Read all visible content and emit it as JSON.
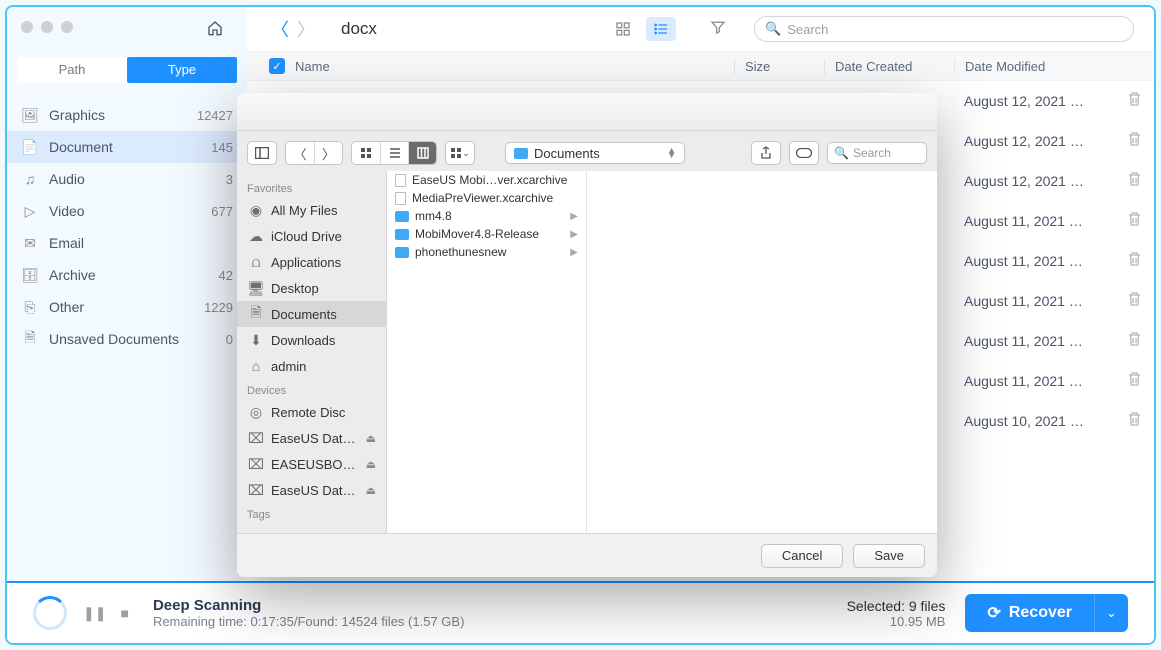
{
  "tabs": {
    "path": "Path",
    "type": "Type"
  },
  "categories": [
    {
      "icon": "image",
      "label": "Graphics",
      "count": "12427"
    },
    {
      "icon": "doc",
      "label": "Document",
      "count": "145",
      "active": true
    },
    {
      "icon": "audio",
      "label": "Audio",
      "count": "3"
    },
    {
      "icon": "video",
      "label": "Video",
      "count": "677"
    },
    {
      "icon": "email",
      "label": "Email",
      "count": ""
    },
    {
      "icon": "archive",
      "label": "Archive",
      "count": "42"
    },
    {
      "icon": "other",
      "label": "Other",
      "count": "1229"
    },
    {
      "icon": "unsaved",
      "label": "Unsaved Documents",
      "count": "0"
    }
  ],
  "breadcrumb": "docx",
  "search_placeholder": "Search",
  "cols": {
    "name": "Name",
    "size": "Size",
    "dc": "Date Created",
    "dm": "Date Modified"
  },
  "rows": [
    {
      "dm": "August 12, 2021 …"
    },
    {
      "dm": "August 12, 2021 …"
    },
    {
      "dm": "August 12, 2021 …"
    },
    {
      "dm": "August 11, 2021 …"
    },
    {
      "dm": "August 11, 2021 …"
    },
    {
      "dm": "August 11, 2021 …"
    },
    {
      "dm": "August 11, 2021 …"
    },
    {
      "dm": "August 11, 2021 …"
    },
    {
      "dm": "August 10, 2021 …"
    }
  ],
  "scan": {
    "title": "Deep Scanning",
    "sub": "Remaining time: 0:17:35/Found: 14524 files (1.57 GB)"
  },
  "selected": {
    "t": "Selected: 9 files",
    "s": "10.95 MB"
  },
  "recover": "Recover",
  "dialog": {
    "path_label": "Documents",
    "search_placeholder": "Search",
    "favorites_hdr": "Favorites",
    "favorites": [
      {
        "icon": "all",
        "label": "All My Files"
      },
      {
        "icon": "cloud",
        "label": "iCloud Drive"
      },
      {
        "icon": "apps",
        "label": "Applications"
      },
      {
        "icon": "desk",
        "label": "Desktop"
      },
      {
        "icon": "docs",
        "label": "Documents",
        "sel": true
      },
      {
        "icon": "dl",
        "label": "Downloads"
      },
      {
        "icon": "home",
        "label": "admin"
      }
    ],
    "devices_hdr": "Devices",
    "devices": [
      {
        "icon": "disc",
        "label": "Remote Disc"
      },
      {
        "icon": "hdd",
        "label": "EaseUS Dat…",
        "eject": true
      },
      {
        "icon": "hdd",
        "label": "EASEUSBO…",
        "eject": true
      },
      {
        "icon": "hdd",
        "label": "EaseUS Dat…",
        "eject": true
      }
    ],
    "tags_hdr": "Tags",
    "files": [
      {
        "type": "file",
        "label": "EaseUS Mobi…ver.xcarchive"
      },
      {
        "type": "file",
        "label": "MediaPreViewer.xcarchive"
      },
      {
        "type": "folder",
        "label": "mm4.8",
        "arrow": true
      },
      {
        "type": "folder",
        "label": "MobiMover4.8-Release",
        "arrow": true
      },
      {
        "type": "folder",
        "label": "phonethunesnew",
        "arrow": true
      }
    ],
    "cancel": "Cancel",
    "save": "Save"
  }
}
